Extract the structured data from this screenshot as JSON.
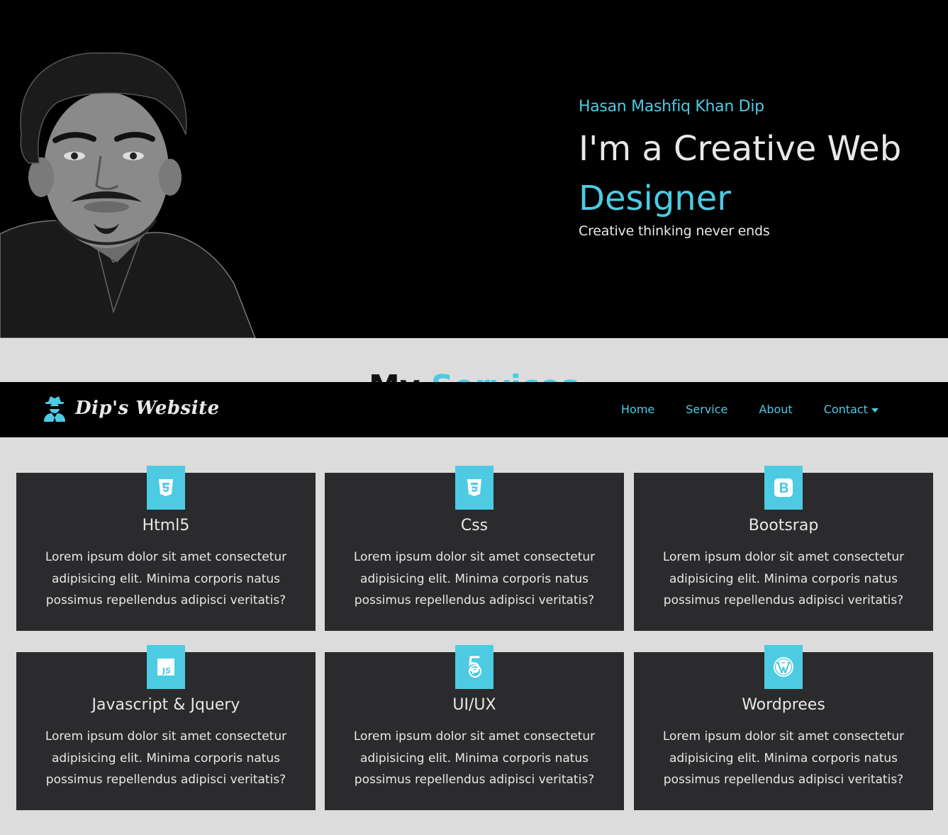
{
  "hero": {
    "name": "Hasan Mashfiq Khan Dip",
    "title_line1": "I'm a Creative Web",
    "title_accent": "Designer",
    "subtitle": "Creative thinking never ends"
  },
  "services": {
    "heading_plain": "My",
    "heading_accent": "Services"
  },
  "navbar": {
    "brand": "Dip's Website",
    "links": [
      "Home",
      "Service",
      "About",
      "Contact"
    ]
  },
  "cards": [
    {
      "title": "Html5",
      "icon": "html5-icon",
      "text": "Lorem ipsum dolor sit amet consectetur adipisicing elit. Minima corporis natus possimus repellendus adipisci veritatis?"
    },
    {
      "title": "Css",
      "icon": "css3-icon",
      "text": "Lorem ipsum dolor sit amet consectetur adipisicing elit. Minima corporis natus possimus repellendus adipisci veritatis?"
    },
    {
      "title": "Bootsrap",
      "icon": "bootstrap-icon",
      "text": "Lorem ipsum dolor sit amet consectetur adipisicing elit. Minima corporis natus possimus repellendus adipisci veritatis?"
    },
    {
      "title": "Javascript & Jquery",
      "icon": "js-icon",
      "text": "Lorem ipsum dolor sit amet consectetur adipisicing elit. Minima corporis natus possimus repellendus adipisci veritatis?"
    },
    {
      "title": "UI/UX",
      "icon": "uiux-icon",
      "text": "Lorem ipsum dolor sit amet consectetur adipisicing elit. Minima corporis natus possimus repellendus adipisci veritatis?"
    },
    {
      "title": "Wordprees",
      "icon": "wordpress-icon",
      "text": "Lorem ipsum dolor sit amet consectetur adipisicing elit. Minima corporis natus possimus repellendus adipisci veritatis?"
    }
  ],
  "colors": {
    "accent": "#4ccbe3",
    "card_bg": "#2b2a2c",
    "page_bg": "#dcdcdc",
    "hero_bg": "#000000"
  }
}
